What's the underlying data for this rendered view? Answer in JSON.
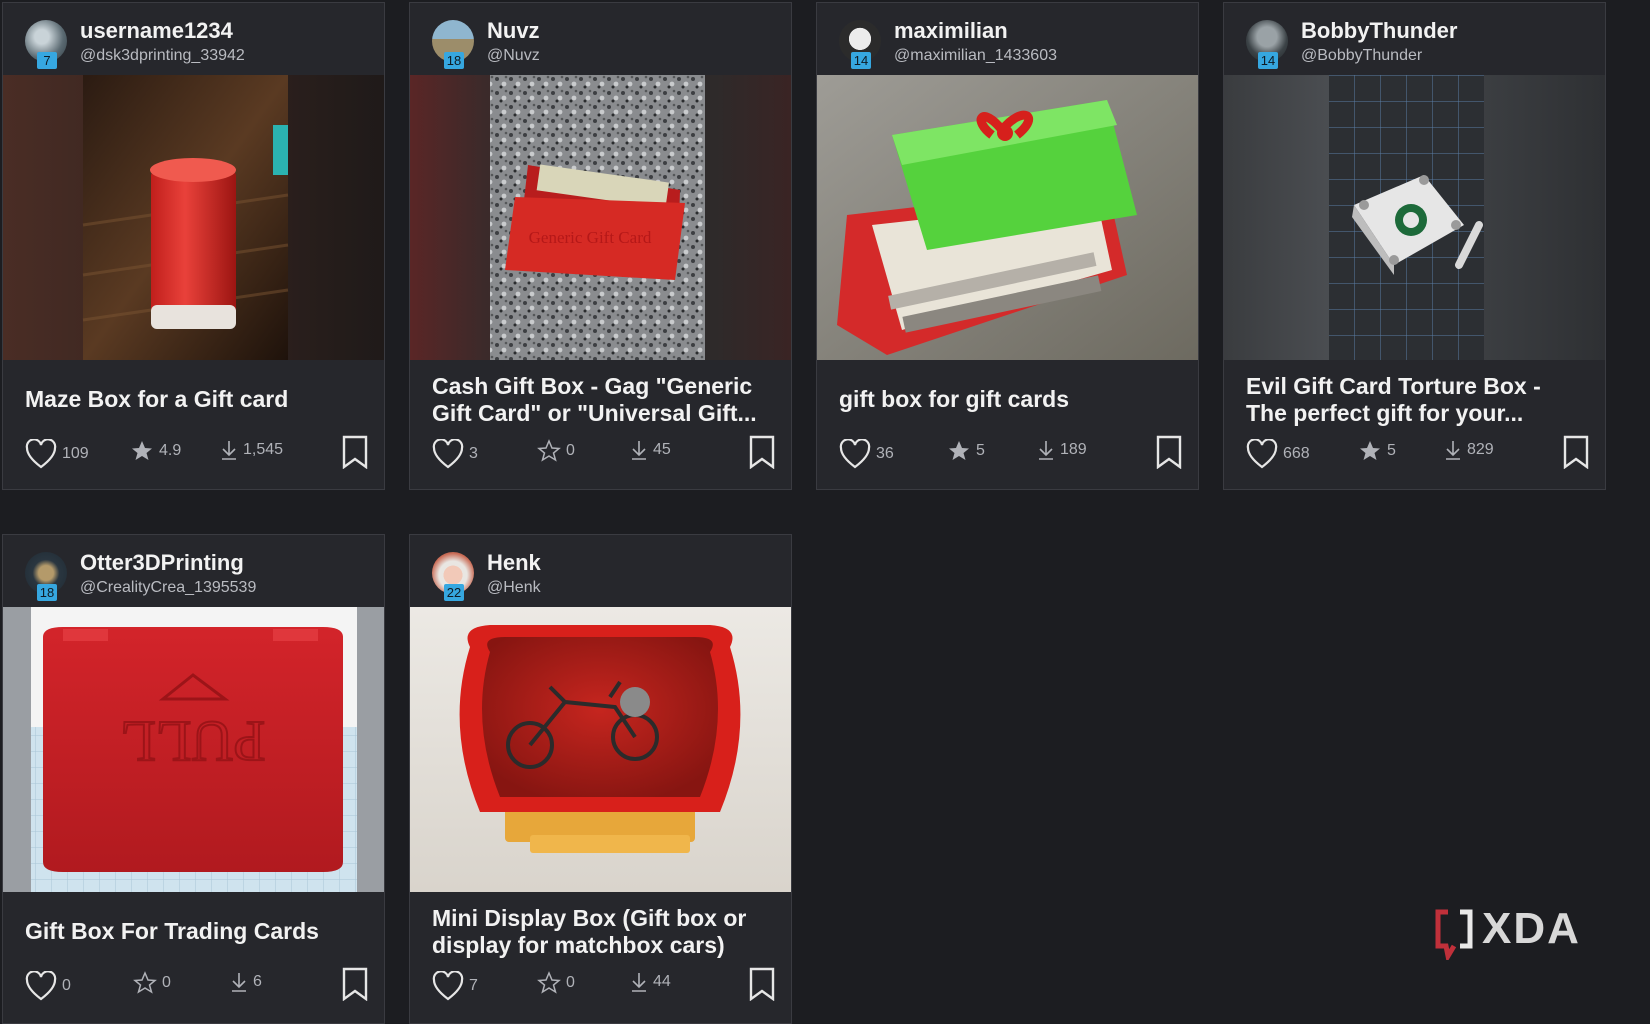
{
  "cards": [
    {
      "username": "username1234",
      "handle": "@dsk3dprinting_33942",
      "level": "7",
      "title": "Maze Box for a Gift card",
      "likes": "109",
      "rating": "4.9",
      "downloads": "1,545",
      "thumb_icon": "red-cylinder-box-photo"
    },
    {
      "username": "Nuvz",
      "handle": "@Nuvz",
      "level": "18",
      "title": "Cash Gift Box - Gag \"Generic Gift Card\" or \"Universal Gift...",
      "likes": "3",
      "rating": "0",
      "downloads": "45",
      "thumb_icon": "red-card-box-photo",
      "thumb_text": "Generic Gift Card"
    },
    {
      "username": "maximilian",
      "handle": "@maximilian_1433603",
      "level": "14",
      "title": "gift box for gift cards",
      "likes": "36",
      "rating": "5",
      "downloads": "189",
      "thumb_icon": "green-red-gift-box-photo"
    },
    {
      "username": "BobbyThunder",
      "handle": "@BobbyThunder",
      "level": "14",
      "title": "Evil Gift Card Torture Box - The perfect gift for your...",
      "likes": "668",
      "rating": "5",
      "downloads": "829",
      "thumb_icon": "white-bolted-box-photo"
    },
    {
      "username": "Otter3DPrinting",
      "handle": "@CrealityCrea_1395539",
      "level": "18",
      "title": "Gift Box For Trading Cards",
      "likes": "0",
      "rating": "0",
      "downloads": "6",
      "thumb_icon": "red-pull-box-render",
      "thumb_text": "PULL"
    },
    {
      "username": "Henk",
      "handle": "@Henk",
      "level": "22",
      "title": "Mini Display Box (Gift box or display for matchbox cars)",
      "likes": "7",
      "rating": "0",
      "downloads": "44",
      "thumb_icon": "red-display-box-photo"
    }
  ],
  "watermark": {
    "text": "XDA",
    "icon": "xda-logo-icon"
  },
  "colors": {
    "background": "#1c1d21",
    "card": "#26272c",
    "level_badge": "#36a7e0",
    "accent_red": "#d42a2a"
  }
}
